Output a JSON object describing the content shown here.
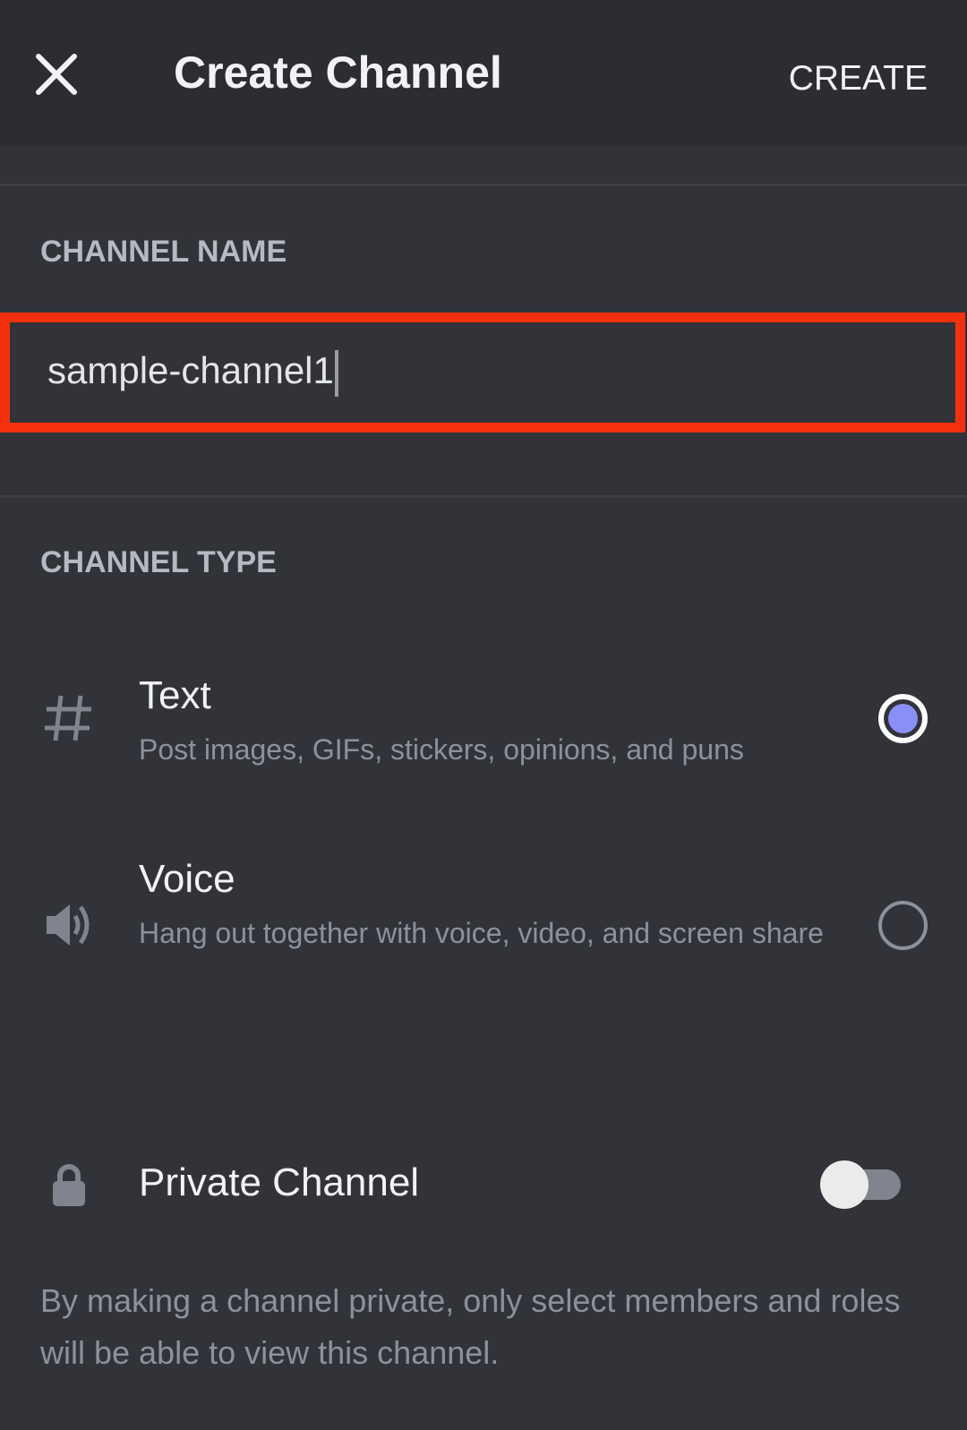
{
  "header": {
    "title": "Create Channel",
    "close_icon": "close-icon",
    "create_label": "CREATE"
  },
  "channel_name": {
    "label": "CHANNEL NAME",
    "value": "sample-channel1",
    "highlight_color": "#f5300f"
  },
  "channel_type": {
    "label": "CHANNEL TYPE",
    "options": [
      {
        "icon": "hash-icon",
        "title": "Text",
        "description": "Post images, GIFs, stickers, opinions, and puns",
        "selected": true
      },
      {
        "icon": "speaker-icon",
        "title": "Voice",
        "description": "Hang out together with voice, video, and screen share",
        "selected": false
      }
    ],
    "accent_color": "#8a8ff7"
  },
  "private_channel": {
    "icon": "lock-icon",
    "label": "Private Channel",
    "enabled": false,
    "description": "By making a channel private, only select members and roles will be able to view this channel."
  }
}
